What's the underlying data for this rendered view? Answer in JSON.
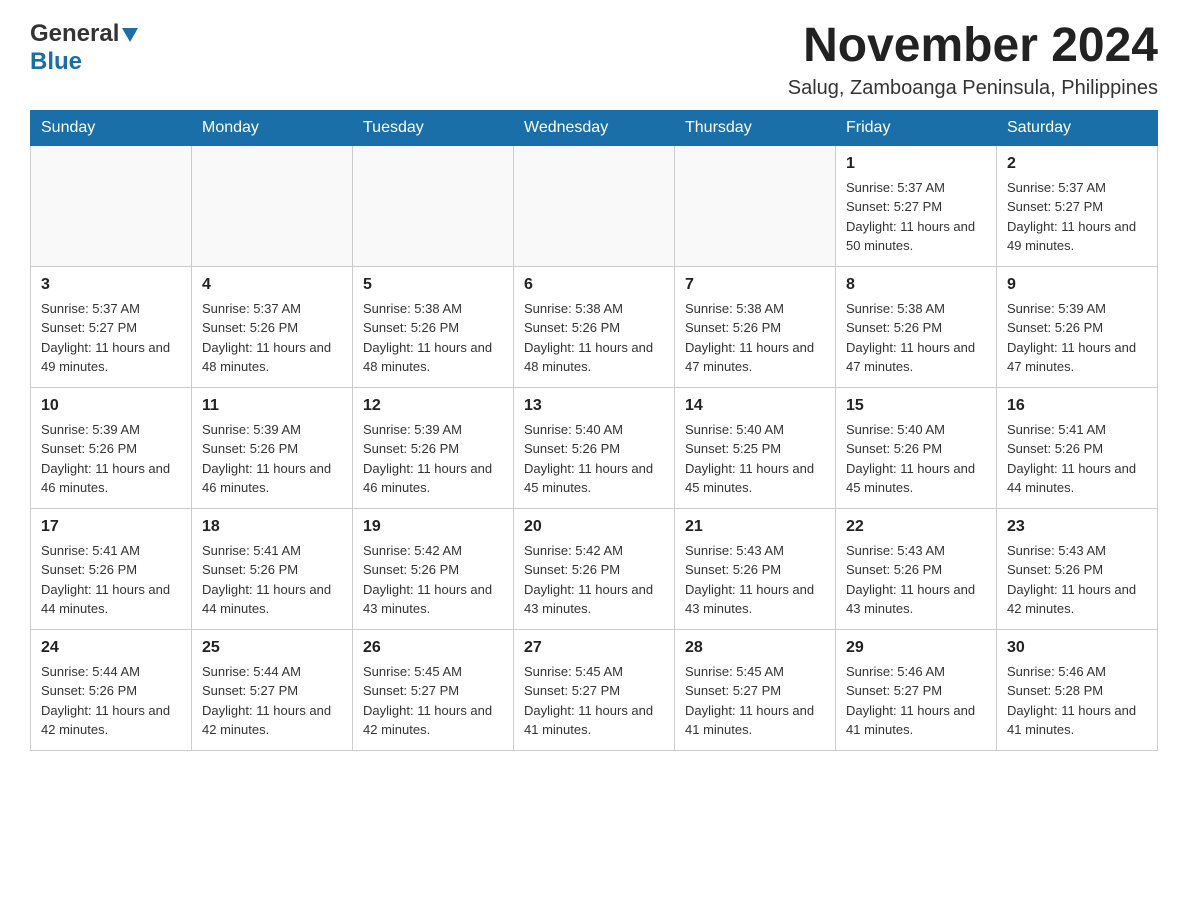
{
  "header": {
    "logo_general": "General",
    "logo_blue": "Blue",
    "month_title": "November 2024",
    "location": "Salug, Zamboanga Peninsula, Philippines"
  },
  "days_of_week": [
    "Sunday",
    "Monday",
    "Tuesday",
    "Wednesday",
    "Thursday",
    "Friday",
    "Saturday"
  ],
  "weeks": [
    [
      {
        "day": "",
        "sunrise": "",
        "sunset": "",
        "daylight": ""
      },
      {
        "day": "",
        "sunrise": "",
        "sunset": "",
        "daylight": ""
      },
      {
        "day": "",
        "sunrise": "",
        "sunset": "",
        "daylight": ""
      },
      {
        "day": "",
        "sunrise": "",
        "sunset": "",
        "daylight": ""
      },
      {
        "day": "",
        "sunrise": "",
        "sunset": "",
        "daylight": ""
      },
      {
        "day": "1",
        "sunrise": "Sunrise: 5:37 AM",
        "sunset": "Sunset: 5:27 PM",
        "daylight": "Daylight: 11 hours and 50 minutes."
      },
      {
        "day": "2",
        "sunrise": "Sunrise: 5:37 AM",
        "sunset": "Sunset: 5:27 PM",
        "daylight": "Daylight: 11 hours and 49 minutes."
      }
    ],
    [
      {
        "day": "3",
        "sunrise": "Sunrise: 5:37 AM",
        "sunset": "Sunset: 5:27 PM",
        "daylight": "Daylight: 11 hours and 49 minutes."
      },
      {
        "day": "4",
        "sunrise": "Sunrise: 5:37 AM",
        "sunset": "Sunset: 5:26 PM",
        "daylight": "Daylight: 11 hours and 48 minutes."
      },
      {
        "day": "5",
        "sunrise": "Sunrise: 5:38 AM",
        "sunset": "Sunset: 5:26 PM",
        "daylight": "Daylight: 11 hours and 48 minutes."
      },
      {
        "day": "6",
        "sunrise": "Sunrise: 5:38 AM",
        "sunset": "Sunset: 5:26 PM",
        "daylight": "Daylight: 11 hours and 48 minutes."
      },
      {
        "day": "7",
        "sunrise": "Sunrise: 5:38 AM",
        "sunset": "Sunset: 5:26 PM",
        "daylight": "Daylight: 11 hours and 47 minutes."
      },
      {
        "day": "8",
        "sunrise": "Sunrise: 5:38 AM",
        "sunset": "Sunset: 5:26 PM",
        "daylight": "Daylight: 11 hours and 47 minutes."
      },
      {
        "day": "9",
        "sunrise": "Sunrise: 5:39 AM",
        "sunset": "Sunset: 5:26 PM",
        "daylight": "Daylight: 11 hours and 47 minutes."
      }
    ],
    [
      {
        "day": "10",
        "sunrise": "Sunrise: 5:39 AM",
        "sunset": "Sunset: 5:26 PM",
        "daylight": "Daylight: 11 hours and 46 minutes."
      },
      {
        "day": "11",
        "sunrise": "Sunrise: 5:39 AM",
        "sunset": "Sunset: 5:26 PM",
        "daylight": "Daylight: 11 hours and 46 minutes."
      },
      {
        "day": "12",
        "sunrise": "Sunrise: 5:39 AM",
        "sunset": "Sunset: 5:26 PM",
        "daylight": "Daylight: 11 hours and 46 minutes."
      },
      {
        "day": "13",
        "sunrise": "Sunrise: 5:40 AM",
        "sunset": "Sunset: 5:26 PM",
        "daylight": "Daylight: 11 hours and 45 minutes."
      },
      {
        "day": "14",
        "sunrise": "Sunrise: 5:40 AM",
        "sunset": "Sunset: 5:25 PM",
        "daylight": "Daylight: 11 hours and 45 minutes."
      },
      {
        "day": "15",
        "sunrise": "Sunrise: 5:40 AM",
        "sunset": "Sunset: 5:26 PM",
        "daylight": "Daylight: 11 hours and 45 minutes."
      },
      {
        "day": "16",
        "sunrise": "Sunrise: 5:41 AM",
        "sunset": "Sunset: 5:26 PM",
        "daylight": "Daylight: 11 hours and 44 minutes."
      }
    ],
    [
      {
        "day": "17",
        "sunrise": "Sunrise: 5:41 AM",
        "sunset": "Sunset: 5:26 PM",
        "daylight": "Daylight: 11 hours and 44 minutes."
      },
      {
        "day": "18",
        "sunrise": "Sunrise: 5:41 AM",
        "sunset": "Sunset: 5:26 PM",
        "daylight": "Daylight: 11 hours and 44 minutes."
      },
      {
        "day": "19",
        "sunrise": "Sunrise: 5:42 AM",
        "sunset": "Sunset: 5:26 PM",
        "daylight": "Daylight: 11 hours and 43 minutes."
      },
      {
        "day": "20",
        "sunrise": "Sunrise: 5:42 AM",
        "sunset": "Sunset: 5:26 PM",
        "daylight": "Daylight: 11 hours and 43 minutes."
      },
      {
        "day": "21",
        "sunrise": "Sunrise: 5:43 AM",
        "sunset": "Sunset: 5:26 PM",
        "daylight": "Daylight: 11 hours and 43 minutes."
      },
      {
        "day": "22",
        "sunrise": "Sunrise: 5:43 AM",
        "sunset": "Sunset: 5:26 PM",
        "daylight": "Daylight: 11 hours and 43 minutes."
      },
      {
        "day": "23",
        "sunrise": "Sunrise: 5:43 AM",
        "sunset": "Sunset: 5:26 PM",
        "daylight": "Daylight: 11 hours and 42 minutes."
      }
    ],
    [
      {
        "day": "24",
        "sunrise": "Sunrise: 5:44 AM",
        "sunset": "Sunset: 5:26 PM",
        "daylight": "Daylight: 11 hours and 42 minutes."
      },
      {
        "day": "25",
        "sunrise": "Sunrise: 5:44 AM",
        "sunset": "Sunset: 5:27 PM",
        "daylight": "Daylight: 11 hours and 42 minutes."
      },
      {
        "day": "26",
        "sunrise": "Sunrise: 5:45 AM",
        "sunset": "Sunset: 5:27 PM",
        "daylight": "Daylight: 11 hours and 42 minutes."
      },
      {
        "day": "27",
        "sunrise": "Sunrise: 5:45 AM",
        "sunset": "Sunset: 5:27 PM",
        "daylight": "Daylight: 11 hours and 41 minutes."
      },
      {
        "day": "28",
        "sunrise": "Sunrise: 5:45 AM",
        "sunset": "Sunset: 5:27 PM",
        "daylight": "Daylight: 11 hours and 41 minutes."
      },
      {
        "day": "29",
        "sunrise": "Sunrise: 5:46 AM",
        "sunset": "Sunset: 5:27 PM",
        "daylight": "Daylight: 11 hours and 41 minutes."
      },
      {
        "day": "30",
        "sunrise": "Sunrise: 5:46 AM",
        "sunset": "Sunset: 5:28 PM",
        "daylight": "Daylight: 11 hours and 41 minutes."
      }
    ]
  ]
}
